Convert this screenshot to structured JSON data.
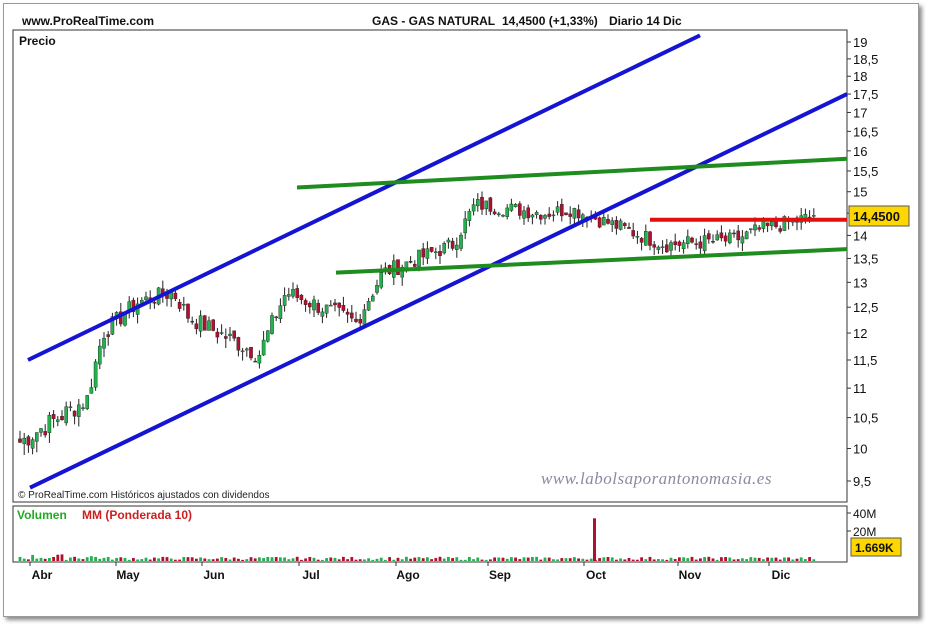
{
  "header": {
    "site": "www.ProRealTime.com",
    "instrument": "GAS - GAS NATURAL",
    "quote": "14,4500 (+1,33%)",
    "period": "Diario  14 Dic"
  },
  "price_panel": {
    "title": "Precio",
    "last_price_label": "14,4500",
    "copyright": "© ProRealTime.com  Históricos ajustados con dividendos",
    "watermark": "www.labolsaporantonomasia.es"
  },
  "volume_panel": {
    "label_volumen": "Volumen",
    "label_mm": "MM (Ponderada 10)",
    "last_volume_label": "1.669K",
    "y_ticks": [
      "40M",
      "20M"
    ]
  },
  "colors": {
    "up": "#22b14c",
    "down": "#b01030",
    "channel": "#1414d2",
    "trendline": "#1e8c1e",
    "resistance": "#e01010",
    "last_box": "#ffd700",
    "volume_label": "#22aa22",
    "mm_label": "#cc2020"
  },
  "chart_data": {
    "type": "candlestick",
    "x_labels": [
      "Abr",
      "May",
      "Jun",
      "Jul",
      "Ago",
      "Sep",
      "Oct",
      "Nov",
      "Dic"
    ],
    "y_ticks": [
      "19",
      "18,5",
      "18",
      "17,5",
      "17",
      "16,5",
      "16",
      "15,5",
      "15",
      "14,5",
      "14",
      "13,5",
      "13",
      "12,5",
      "12",
      "11,5",
      "11",
      "10,5",
      "10",
      "9,5"
    ],
    "ylim": [
      9.3,
      19.2
    ],
    "scale": "log",
    "close_path": [
      [
        "Abr",
        10.1
      ],
      [
        "Abr",
        10.8
      ],
      [
        "May",
        12.0
      ],
      [
        "May",
        12.6
      ],
      [
        "May",
        12.8
      ],
      [
        "Jun",
        12.3
      ],
      [
        "Jun",
        11.6
      ],
      [
        "Jul",
        12.8
      ],
      [
        "Jul",
        12.2
      ],
      [
        "Ago",
        13.2
      ],
      [
        "Ago",
        13.8
      ],
      [
        "Sep",
        14.7
      ],
      [
        "Sep",
        14.5
      ],
      [
        "Oct",
        14.6
      ],
      [
        "Oct",
        14.0
      ],
      [
        "Nov",
        13.8
      ],
      [
        "Nov",
        13.9
      ],
      [
        "Dic",
        14.1
      ],
      [
        "Dic",
        14.45
      ]
    ],
    "last_close": 14.45,
    "lines": [
      {
        "name": "canal-superior",
        "color": "blue",
        "from": [
          "Abr",
          11.5
        ],
        "to": [
          "Sep",
          19.2
        ]
      },
      {
        "name": "canal-inferior",
        "color": "blue",
        "from": [
          "Abr",
          9.4
        ],
        "to": [
          "Dic",
          17.5
        ]
      },
      {
        "name": "tendencia-superior",
        "color": "green",
        "from": [
          "Jul",
          15.1
        ],
        "to": [
          "Dic",
          15.8
        ]
      },
      {
        "name": "tendencia-inferior",
        "color": "green",
        "from": [
          "Jul",
          13.2
        ],
        "to": [
          "Dic",
          13.7
        ]
      },
      {
        "name": "resistencia",
        "color": "red",
        "from": [
          "Oct",
          14.35
        ],
        "to": [
          "Dic",
          14.35
        ]
      }
    ],
    "volume": {
      "ylim": [
        0,
        45
      ],
      "typical_range": [
        1,
        4
      ],
      "peak_month": "Oct",
      "peak_value": 40,
      "last_value": 1.669
    }
  }
}
